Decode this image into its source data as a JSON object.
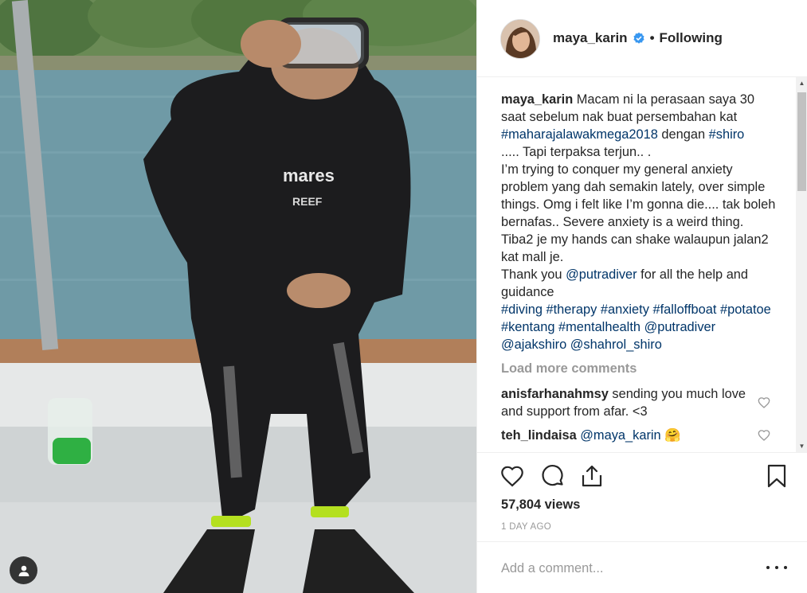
{
  "post": {
    "username": "maya_karin",
    "follow_state": "Following",
    "separator": "•",
    "caption": {
      "username": "maya_karin",
      "segments": [
        {
          "t": "text",
          "v": " Macam ni la perasaan saya 30 saat sebelum nak buat persembahan kat "
        },
        {
          "t": "tag",
          "v": "#maharajalawakmega2018"
        },
        {
          "t": "text",
          "v": " dengan "
        },
        {
          "t": "tag",
          "v": "#shiro"
        },
        {
          "t": "br"
        },
        {
          "t": "text",
          "v": "..... Tapi terpaksa terjun.. ."
        },
        {
          "t": "br"
        },
        {
          "t": "text",
          "v": "I’m trying to conquer my general anxiety problem yang dah semakin lately, over simple things. Omg i felt like I’m gonna die.... tak boleh bernafas.. Severe anxiety is a weird thing. Tiba2 je my hands can shake walaupun jalan2 kat mall je."
        },
        {
          "t": "br"
        },
        {
          "t": "text",
          "v": "Thank you "
        },
        {
          "t": "tag",
          "v": "@putradiver"
        },
        {
          "t": "text",
          "v": " for all the help and guidance"
        },
        {
          "t": "br"
        },
        {
          "t": "tag",
          "v": "#diving"
        },
        {
          "t": "text",
          "v": " "
        },
        {
          "t": "tag",
          "v": "#therapy"
        },
        {
          "t": "text",
          "v": " "
        },
        {
          "t": "tag",
          "v": "#anxiety"
        },
        {
          "t": "text",
          "v": " "
        },
        {
          "t": "tag",
          "v": "#falloffboat"
        },
        {
          "t": "text",
          "v": " "
        },
        {
          "t": "tag",
          "v": "#potatoe"
        },
        {
          "t": "text",
          "v": " "
        },
        {
          "t": "tag",
          "v": "#kentang"
        },
        {
          "t": "text",
          "v": " "
        },
        {
          "t": "tag",
          "v": "#mentalhealth"
        },
        {
          "t": "text",
          "v": " "
        },
        {
          "t": "tag",
          "v": "@putradiver"
        },
        {
          "t": "text",
          "v": " "
        },
        {
          "t": "tag",
          "v": "@ajakshiro"
        },
        {
          "t": "text",
          "v": " "
        },
        {
          "t": "tag",
          "v": "@shahrol_shiro"
        }
      ]
    },
    "load_more_label": "Load more comments",
    "comments": [
      {
        "username": "anisfarhanahmsy",
        "text": " sending you much love and support from afar. <3",
        "mention": ""
      },
      {
        "username": "teh_lindaisa",
        "text": " 🤗",
        "mention": "@maya_karin"
      }
    ],
    "views": "57,804 views",
    "date": "1 DAY AGO",
    "add_comment_placeholder": "Add a comment..."
  },
  "colors": {
    "text": "#262626",
    "muted": "#999999",
    "link": "#003569",
    "verified": "#3897f0",
    "border": "#efefef"
  },
  "icons": {
    "like": "heart-icon",
    "comment": "comment-bubble-icon",
    "share": "share-icon",
    "save": "bookmark-icon",
    "more": "more-options-icon",
    "user_tags": "user-tag-icon",
    "verified": "verified-badge-icon"
  }
}
